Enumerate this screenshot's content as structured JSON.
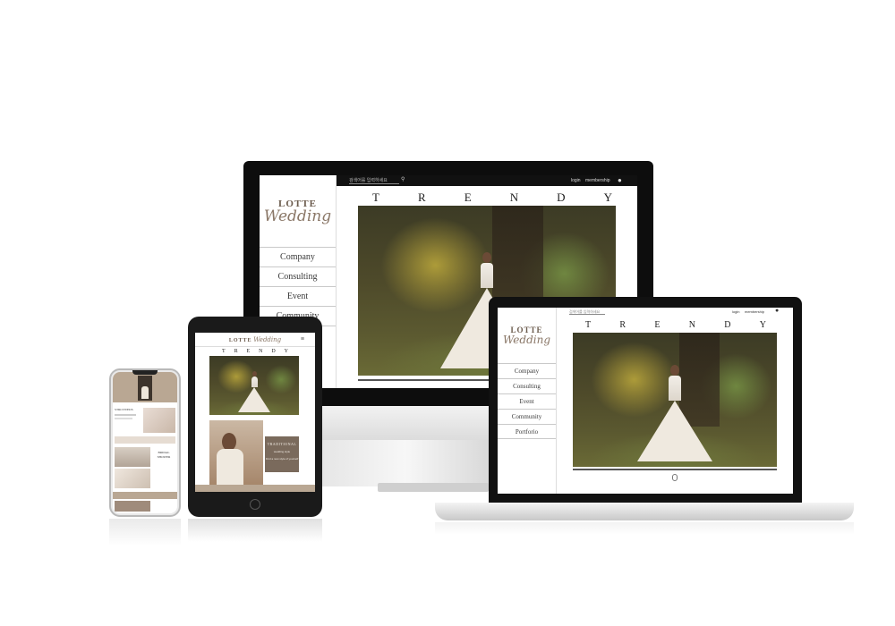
{
  "site": {
    "logo_top": "LOTTE",
    "logo_script": "Wedding",
    "hero_heading": [
      "T",
      "R",
      "E",
      "N",
      "D",
      "Y"
    ],
    "search_placeholder": "검색어를 입력하세요",
    "login_label": "login",
    "membership_label": "membership",
    "nav_items": [
      "Company",
      "Consulting",
      "Event",
      "Community",
      "Portforio"
    ]
  },
  "tablet": {
    "promo_title": "TRADITIONAL",
    "promo_sub": "wedding style",
    "promo_note": "Find a new style of yourself"
  },
  "phone": {
    "card_title": "STRLYWEDS",
    "card_title_2": "BRIDAL SHOWER"
  },
  "colors": {
    "accent_taupe": "#b9a793",
    "promo_bg": "#7a6a5c",
    "text_dark": "#1e1e1e"
  }
}
